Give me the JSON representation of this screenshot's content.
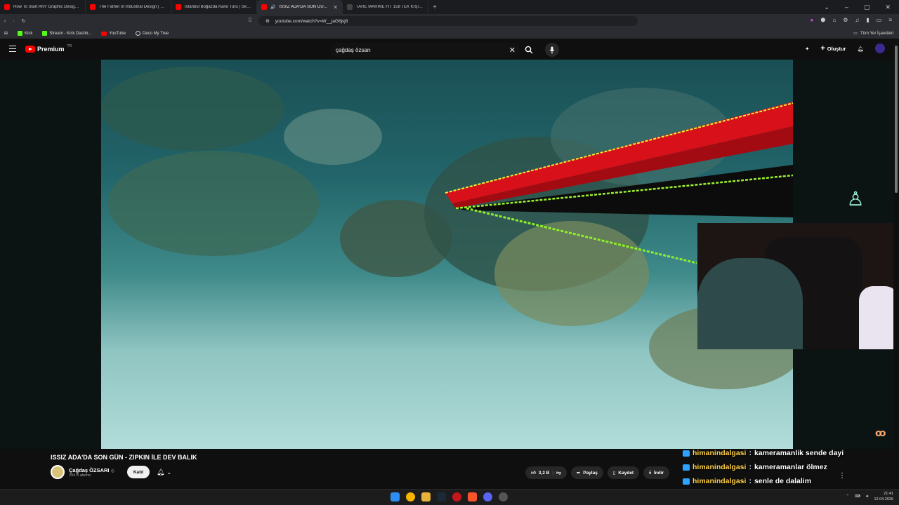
{
  "browser": {
    "tabs": [
      {
        "title": "How To Start ANY Graphic Design Fr",
        "active": false
      },
      {
        "title": "The Father of Industrial Design | Dier",
        "active": false
      },
      {
        "title": "İstanbul Boğazda Kano Turu | Sea Ka",
        "active": false
      },
      {
        "title": "ISSIZ ADA'DA SON GÜN - ZIP",
        "active": true
      },
      {
        "title": "TAHE MARINE FIT 158 TEK KİŞİLİK SU",
        "active": false
      }
    ],
    "url": "youtube.com/watch?v=W__jaG6jsj8",
    "bookmarks": [
      "Kick",
      "Stream - Kick Dashb...",
      "YouTube",
      "Deco My Tree"
    ],
    "all_bookmarks": "Tüm Yer İşaretleri"
  },
  "youtube": {
    "logo_text": "Premium",
    "logo_region": "TR",
    "search_query": "çağdaş özsarı",
    "create_label": "Oluştur"
  },
  "video": {
    "title": "ISSIZ ADA'DA SON GÜN - ZIPKIN İLE DEV BALIK",
    "channel": "Çağdaş ÖZSARI",
    "verified_mark": "◎",
    "subscribers": "294 B abone",
    "join_label": "Katıl",
    "likes": "3,2 B",
    "share_label": "Paylaş",
    "save_label": "Kaydet",
    "download_label": "İndir"
  },
  "chat": [
    {
      "user": "himanindalgasi",
      "message": "kameramanlik sende dayi"
    },
    {
      "user": "himanindalgasi",
      "message": "kameramanlar ölmez"
    },
    {
      "user": "himanindalgasi",
      "message": "senle de dalalim"
    }
  ],
  "taskbar": {
    "time": "21:41",
    "date": "12.04.2026"
  },
  "colors": {
    "youtube_red": "#ff0000",
    "chat_username": "#ffd24a",
    "kick_green": "#53fc18"
  }
}
